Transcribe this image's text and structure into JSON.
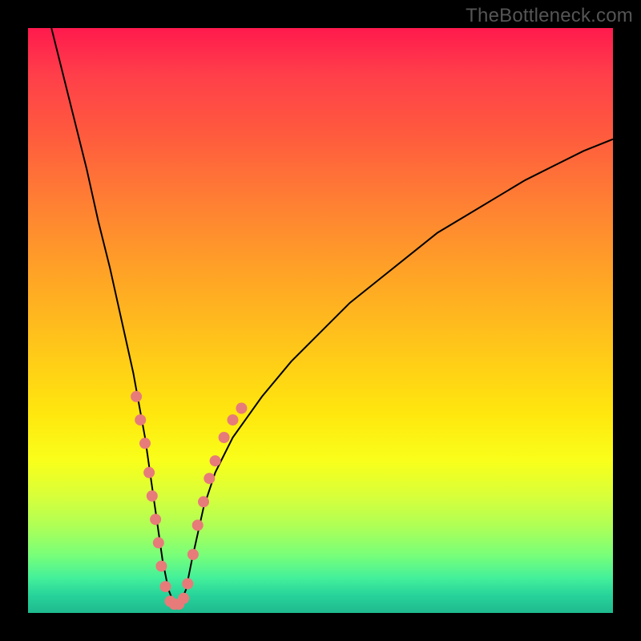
{
  "watermark": "TheBottleneck.com",
  "colors": {
    "frame": "#000000",
    "curve": "#000000",
    "dot": "#e77b79",
    "gradient_top": "#ff1a4d",
    "gradient_bottom": "#1fb98e"
  },
  "chart_data": {
    "type": "line",
    "title": "",
    "xlabel": "",
    "ylabel": "",
    "xlim": [
      0,
      100
    ],
    "ylim": [
      0,
      100
    ],
    "series": [
      {
        "name": "bottleneck-curve",
        "x": [
          4,
          6,
          8,
          10,
          12,
          14,
          16,
          18,
          20,
          22,
          23,
          24,
          25,
          26,
          27,
          28,
          30,
          32,
          35,
          40,
          45,
          50,
          55,
          60,
          65,
          70,
          75,
          80,
          85,
          90,
          95,
          100
        ],
        "y": [
          100,
          92,
          84,
          76,
          67,
          59,
          50,
          41,
          30,
          16,
          9,
          4,
          1.5,
          1.5,
          4,
          9,
          18,
          24,
          30,
          37,
          43,
          48,
          53,
          57,
          61,
          65,
          68,
          71,
          74,
          76.5,
          79,
          81
        ]
      }
    ],
    "markers": {
      "name": "highlight-dots",
      "points": [
        {
          "x": 18.5,
          "y": 37
        },
        {
          "x": 19.2,
          "y": 33
        },
        {
          "x": 20.0,
          "y": 29
        },
        {
          "x": 20.7,
          "y": 24
        },
        {
          "x": 21.2,
          "y": 20
        },
        {
          "x": 21.8,
          "y": 16
        },
        {
          "x": 22.3,
          "y": 12
        },
        {
          "x": 22.8,
          "y": 8
        },
        {
          "x": 23.5,
          "y": 4.5
        },
        {
          "x": 24.3,
          "y": 2
        },
        {
          "x": 25.0,
          "y": 1.5
        },
        {
          "x": 25.8,
          "y": 1.5
        },
        {
          "x": 26.6,
          "y": 2.5
        },
        {
          "x": 27.3,
          "y": 5
        },
        {
          "x": 28.2,
          "y": 10
        },
        {
          "x": 29.0,
          "y": 15
        },
        {
          "x": 30.0,
          "y": 19
        },
        {
          "x": 31.0,
          "y": 23
        },
        {
          "x": 32.0,
          "y": 26
        },
        {
          "x": 33.5,
          "y": 30
        },
        {
          "x": 35.0,
          "y": 33
        },
        {
          "x": 36.5,
          "y": 35
        }
      ],
      "radius": 7
    }
  }
}
